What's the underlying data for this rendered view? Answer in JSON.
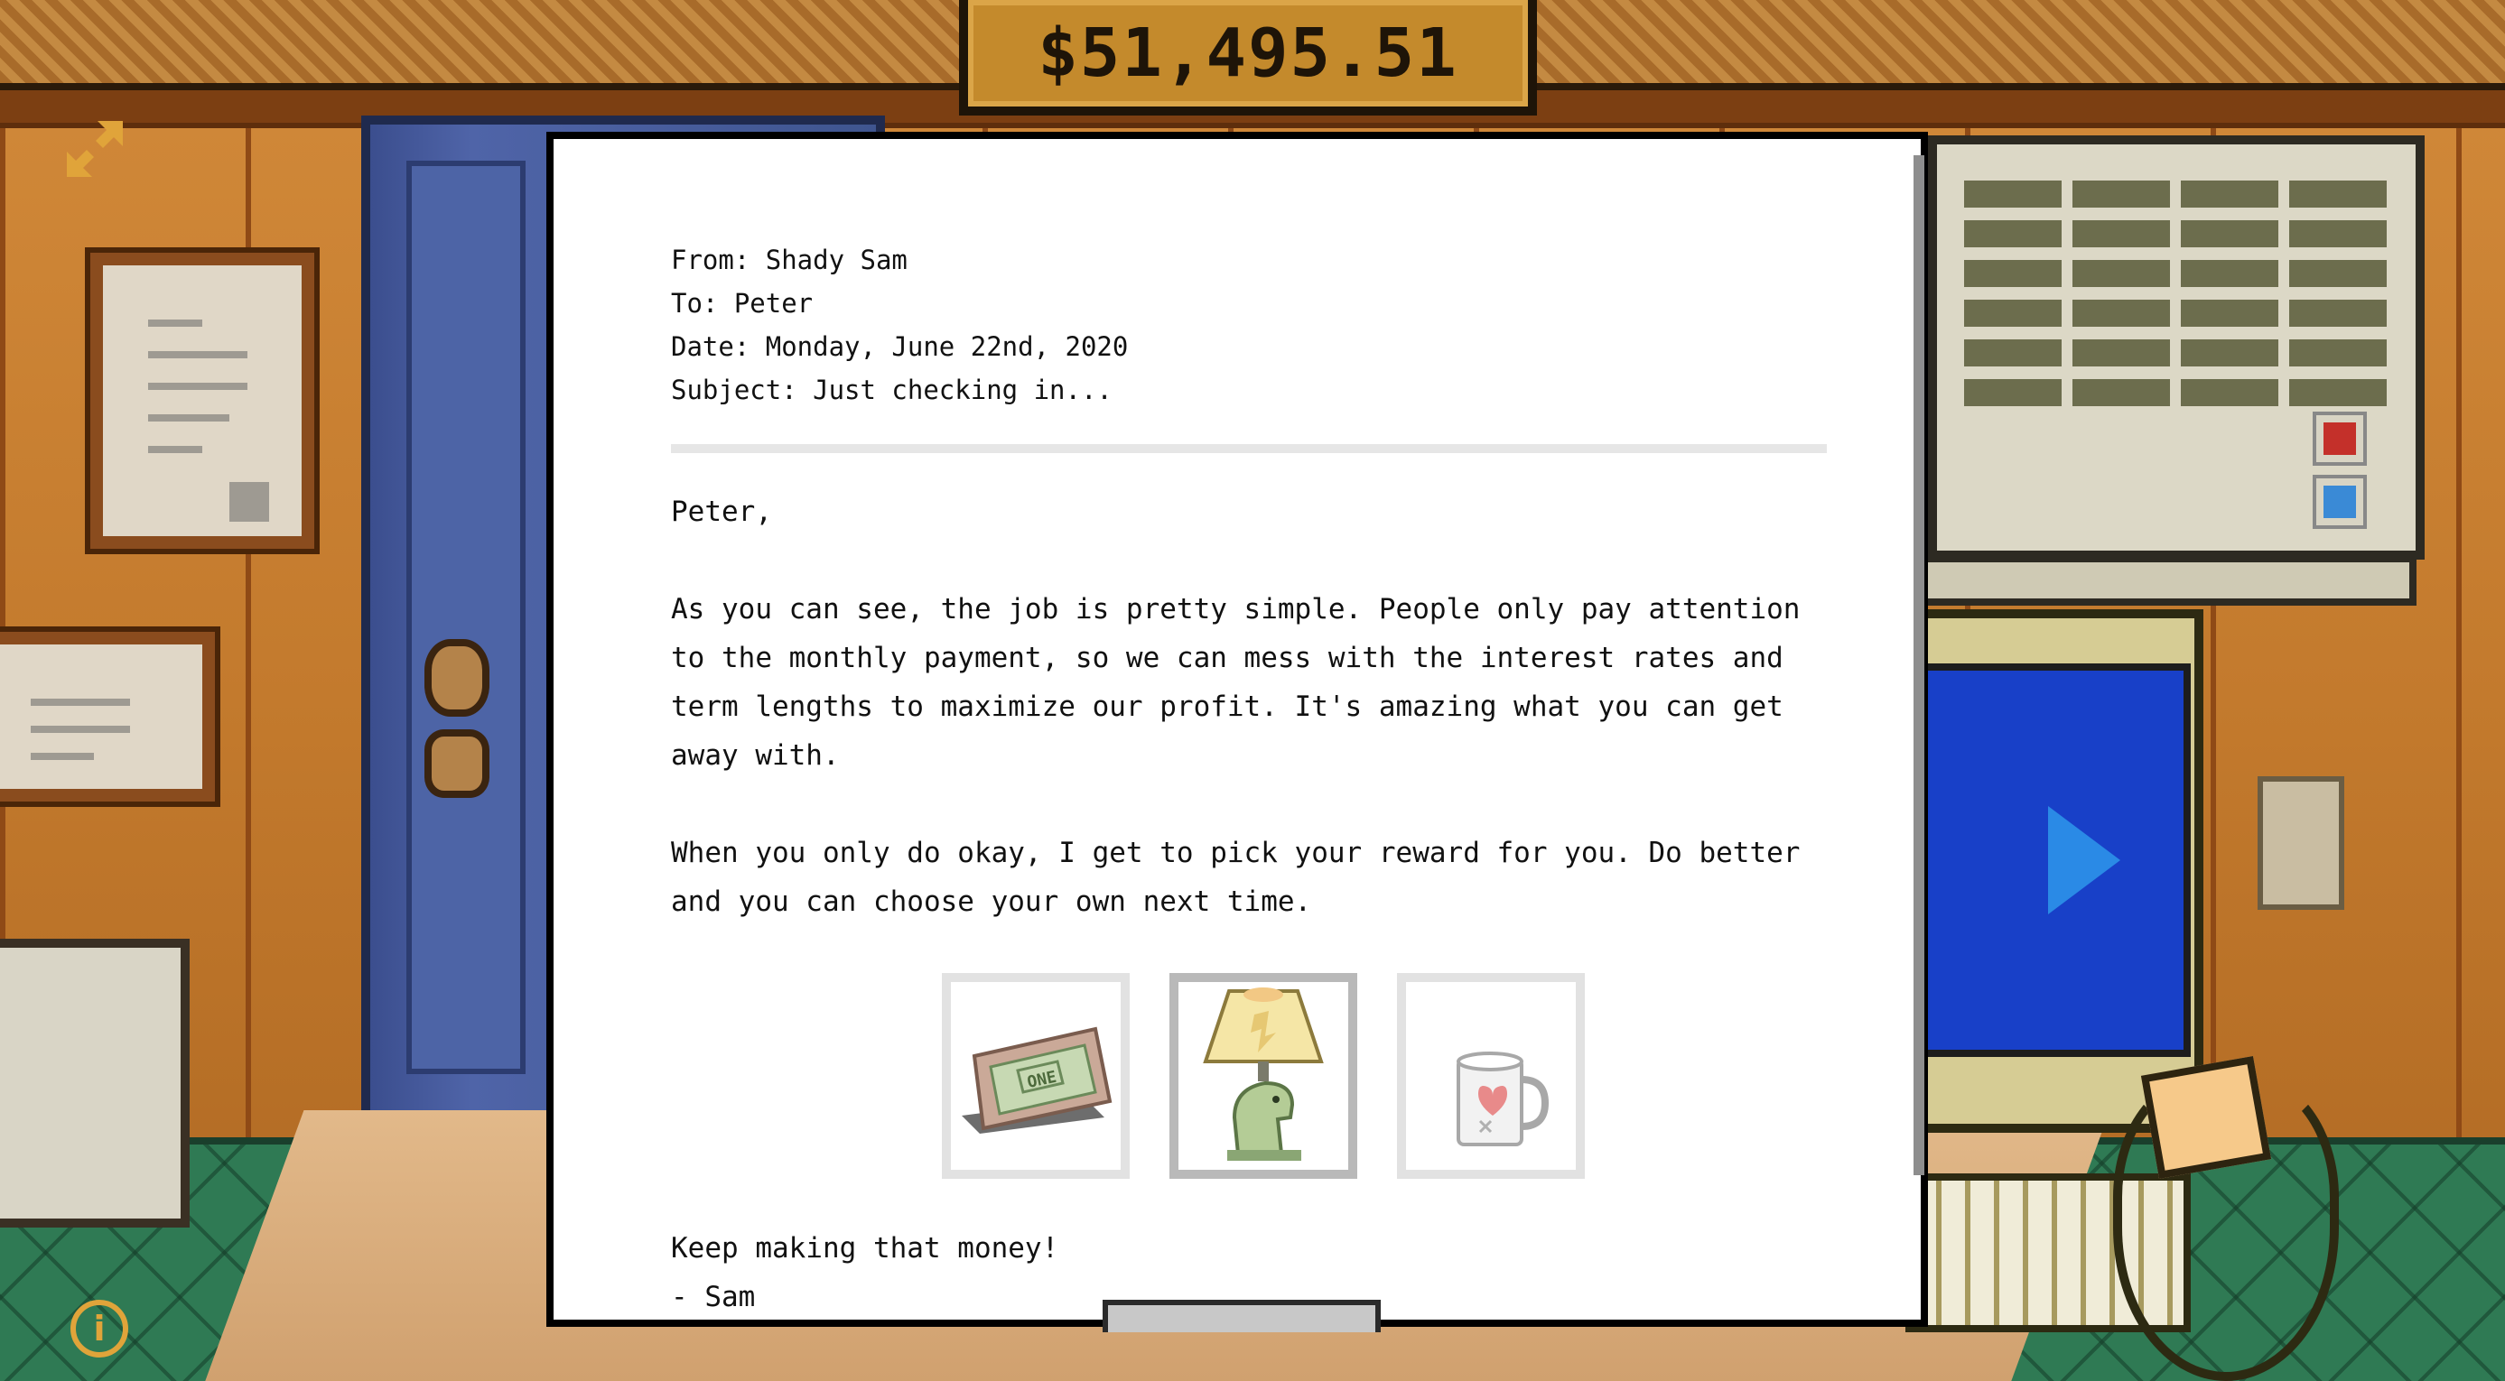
{
  "hud": {
    "money": "$51,495.51",
    "expand_icon": "expand-arrows-icon",
    "info_icon": "info-icon",
    "info_glyph": "i"
  },
  "email": {
    "from": "From: Shady Sam",
    "to": "To: Peter",
    "date": "Date: Monday, June 22nd, 2020",
    "subject": "Subject: Just checking in...",
    "greeting": "Peter,",
    "body_1": "As you can see, the job is pretty simple. People only pay attention to the monthly payment, so we can mess with the interest rates and term lengths to maximize our profit. It's amazing what you can get away with.",
    "body_2": "When you only do okay, I get to pick your reward for you. Do better and you can choose your own next time.",
    "rewards": [
      {
        "icon": "framed-dollar-bill-icon",
        "bill_text": "ONE",
        "selected": false
      },
      {
        "icon": "dinosaur-lamp-icon",
        "selected": true
      },
      {
        "icon": "heart-mug-icon",
        "selected": false
      }
    ],
    "closing": "Keep making that money!",
    "signature": "- Sam"
  },
  "colors": {
    "money_plate": "#c48a2c",
    "hud_accent": "#e0a43a",
    "email_bg": "#ffffff",
    "wall": "#c98a3e",
    "carpet": "#2f7a54",
    "door": "#4f64a8",
    "monitor_screen": "#1840c8"
  }
}
